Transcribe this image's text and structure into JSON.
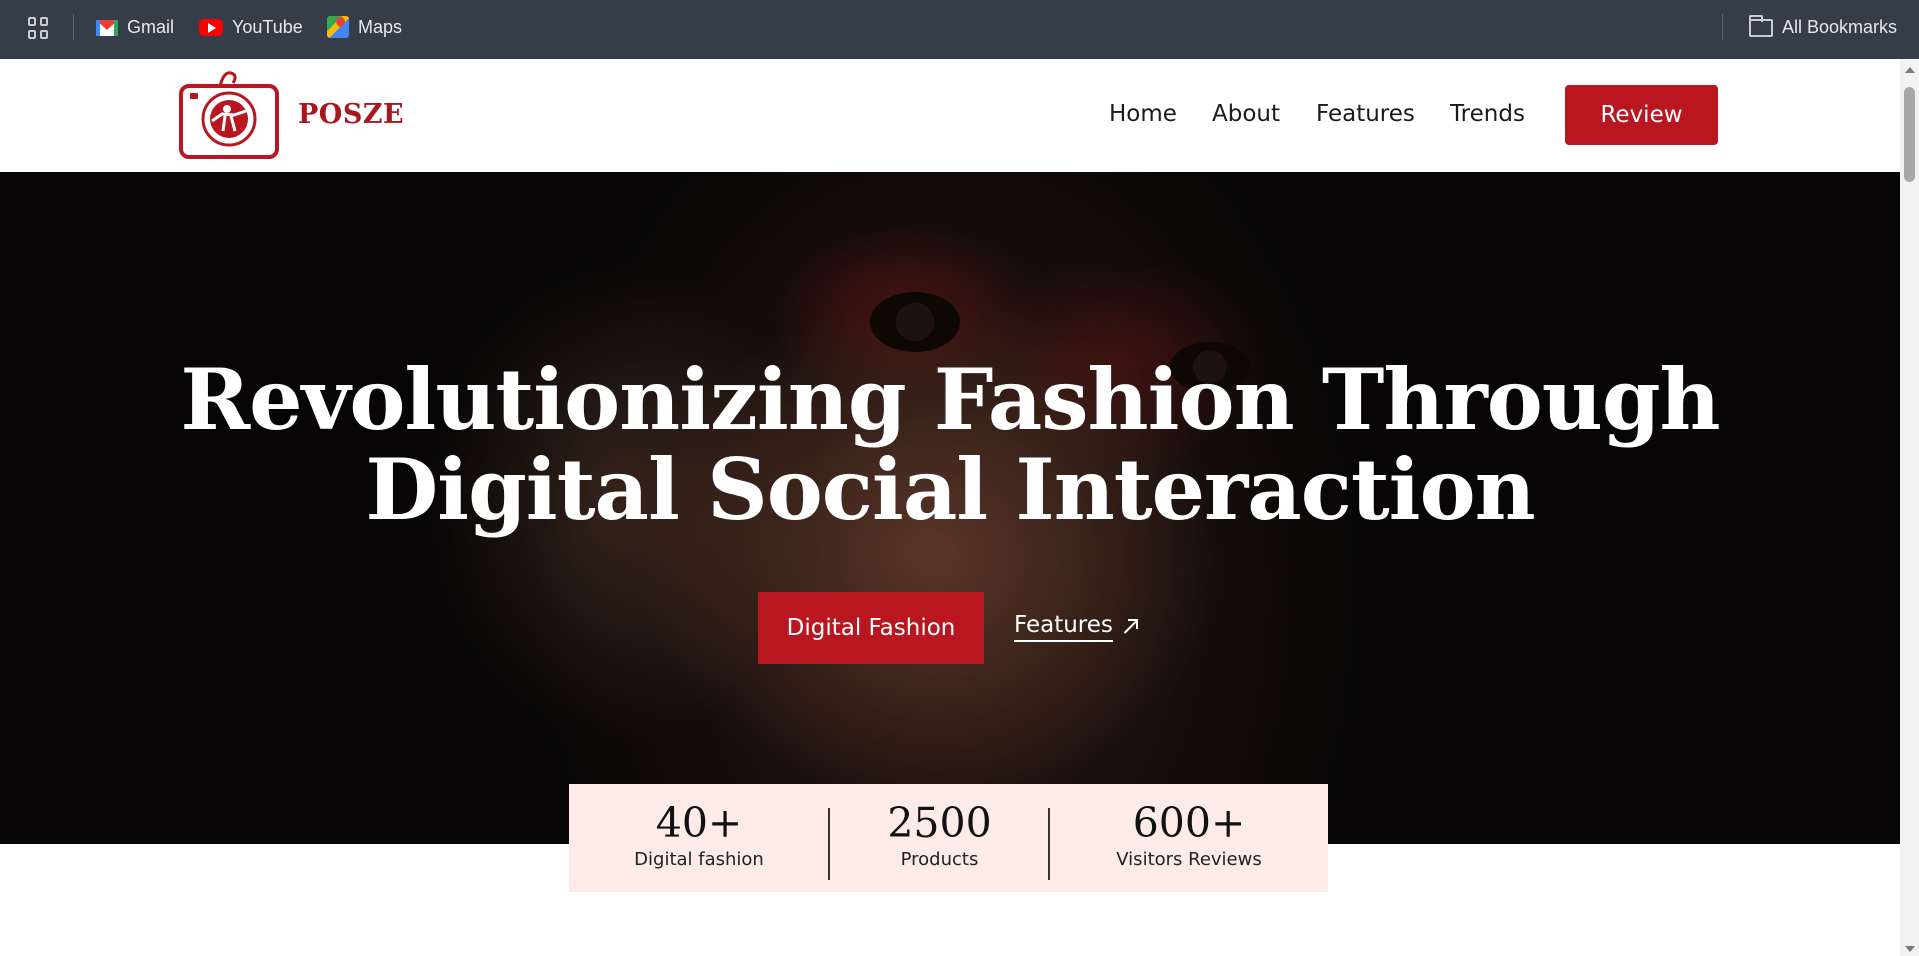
{
  "bookmarks": {
    "items": [
      {
        "label": "Gmail",
        "icon": "gmail-icon"
      },
      {
        "label": "YouTube",
        "icon": "youtube-icon"
      },
      {
        "label": "Maps",
        "icon": "maps-icon"
      }
    ],
    "all_bookmarks": "All Bookmarks"
  },
  "header": {
    "brand": "POSZE",
    "nav": [
      "Home",
      "About",
      "Features",
      "Trends"
    ],
    "cta": "Review"
  },
  "hero": {
    "title_line1": "Revolutionizing Fashion Through",
    "title_line2": "Digital Social Interaction",
    "primary_button": "Digital Fashion",
    "secondary_link": "Features"
  },
  "stats": [
    {
      "value": "40+",
      "label": "Digital fashion"
    },
    {
      "value": "2500",
      "label": "Products"
    },
    {
      "value": "600+",
      "label": "Visitors Reviews"
    }
  ],
  "colors": {
    "bookmarks_bar": "#353d49",
    "brand_red": "#b9161f",
    "stats_bg": "#fcebe6"
  }
}
